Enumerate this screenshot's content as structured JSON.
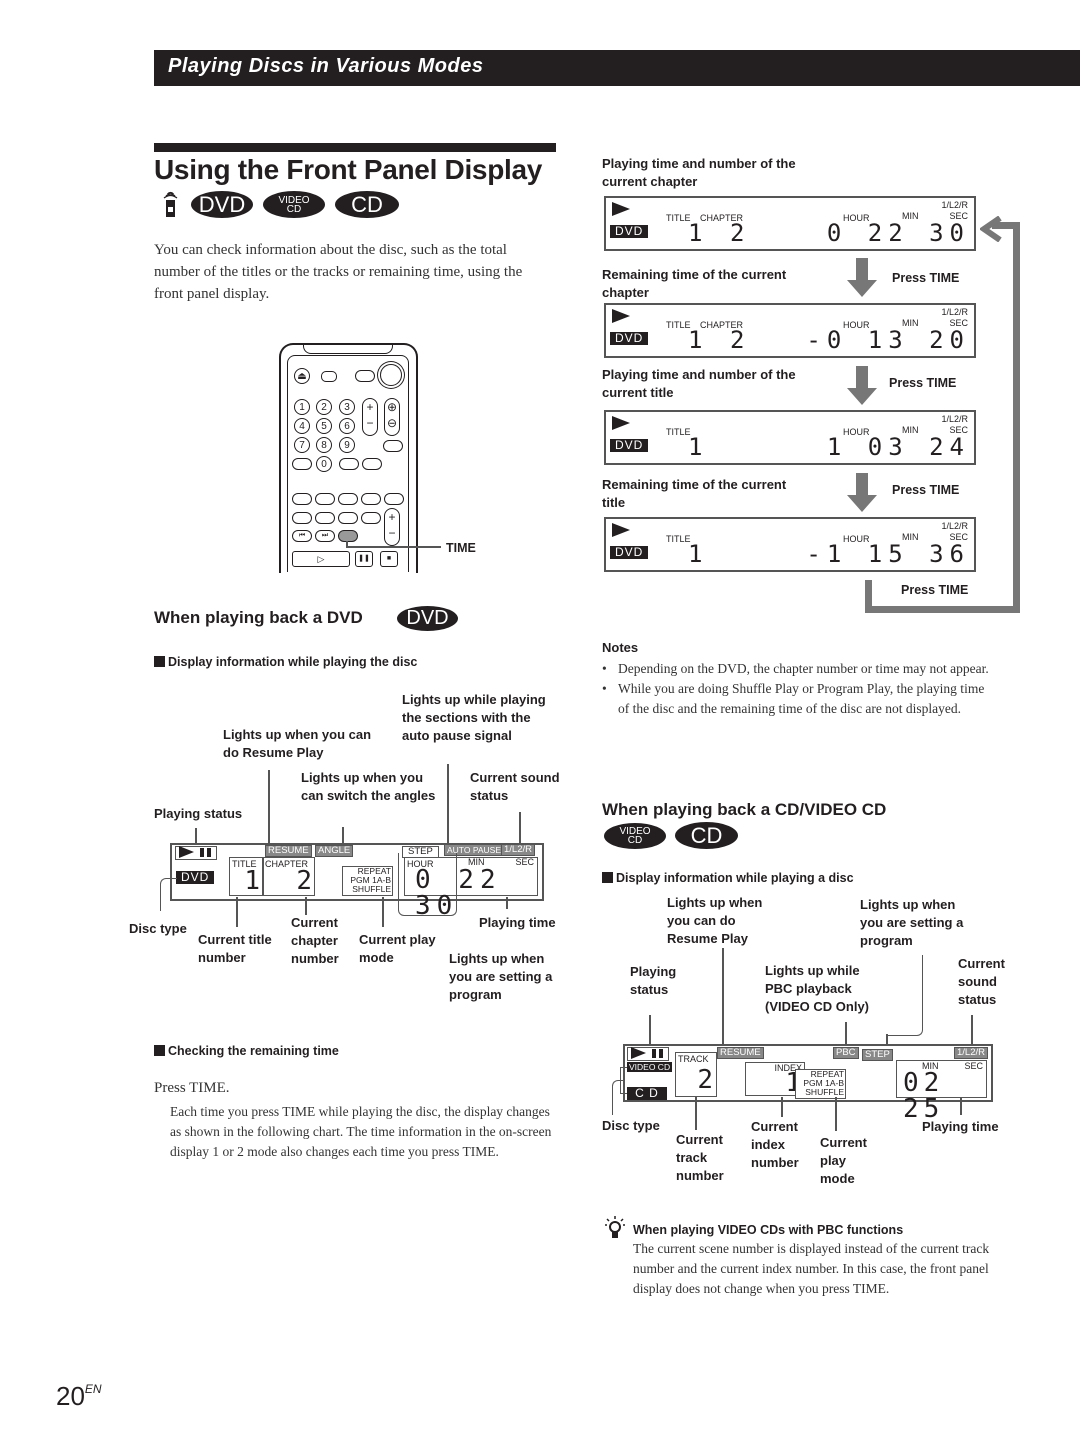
{
  "header": {
    "section_title": "Playing Discs in Various Modes"
  },
  "page": {
    "title": "Using the Front Panel Display",
    "badges": {
      "dvd": "DVD",
      "video_cd_top": "VIDEO",
      "video_cd_bottom": "CD",
      "cd": "CD"
    },
    "intro": "You can check information about the disc, such as the total number of the titles or the tracks or remaining time, using the front panel display.",
    "page_number": "20",
    "page_suffix": "EN"
  },
  "remote": {
    "time_label": "TIME",
    "numbers": [
      "1",
      "2",
      "3",
      "4",
      "5",
      "6",
      "7",
      "8",
      "9",
      "0"
    ]
  },
  "dvd_section": {
    "heading": "When playing back a DVD",
    "badge": "DVD",
    "subheading": "Display information while playing the disc",
    "callouts": {
      "resume": "Lights up when you can do Resume Play",
      "auto_pause": "Lights up while playing the sections with the auto pause signal",
      "angle": "Lights up when you can switch the angles",
      "sound": "Current sound status",
      "playing_status": "Playing status",
      "disc_type": "Disc type",
      "title_number": "Current title number",
      "chapter_number": "Current chapter number",
      "play_mode": "Current play mode",
      "program": "Lights up when you are setting a program",
      "playing_time": "Playing time"
    },
    "display": {
      "disc": "DVD",
      "resume": "RESUME",
      "angle": "ANGLE",
      "step": "STEP",
      "auto_pause": "AUTO PAUSE",
      "audio": "1/L2/R",
      "title_label": "TITLE",
      "chapter_label": "CHAPTER",
      "title_value": "1",
      "chapter_value": "2",
      "mode_lines": [
        "REPEAT",
        "PGM 1A-B",
        "SHUFFLE"
      ],
      "hour_label": "HOUR",
      "min_label": "MIN",
      "sec_label": "SEC",
      "time_value": "0 22 30"
    },
    "remaining": {
      "subheading": "Checking the remaining time",
      "step": "Press TIME.",
      "body": "Each time you press TIME while playing the disc, the display changes as shown in the following chart.  The time information in the on-screen display 1 or 2 mode also changes each time you press TIME."
    }
  },
  "time_chart": {
    "press_label": "Press TIME",
    "states": [
      {
        "caption": "Playing time and number of the current chapter",
        "labels": [
          "TITLE",
          "CHAPTER"
        ],
        "values": [
          "1",
          "2"
        ],
        "time": "0 22 30",
        "disc": "DVD",
        "audio": "1/L2/R"
      },
      {
        "caption": "Remaining time of the current chapter",
        "labels": [
          "TITLE",
          "CHAPTER"
        ],
        "values": [
          "1",
          "2"
        ],
        "time": "-0 13 20",
        "disc": "DVD",
        "audio": "1/L2/R"
      },
      {
        "caption": "Playing time and number of the current title",
        "labels": [
          "TITLE"
        ],
        "values": [
          "1"
        ],
        "time": "1 03 24",
        "disc": "DVD",
        "audio": "1/L2/R"
      },
      {
        "caption": "Remaining time of the current title",
        "labels": [
          "TITLE"
        ],
        "values": [
          "1"
        ],
        "time": "-1 15 36",
        "disc": "DVD",
        "audio": "1/L2/R"
      }
    ],
    "hour_label": "HOUR",
    "min_label": "MIN",
    "sec_label": "SEC"
  },
  "notes": {
    "heading": "Notes",
    "items": [
      "Depending on the DVD, the chapter number or time may not appear.",
      "While you are doing Shuffle Play or Program Play, the playing time of the disc and the remaining time of the disc are not displayed."
    ]
  },
  "cd_section": {
    "heading": "When playing back a CD/VIDEO CD",
    "badges": {
      "video_cd_top": "VIDEO",
      "video_cd_bottom": "CD",
      "cd": "CD"
    },
    "subheading": "Display information while playing a disc",
    "callouts": {
      "resume": "Lights up when you can do Resume Play",
      "program": "Lights up when you are setting a program",
      "playing_status": "Playing status",
      "pbc": "Lights up while PBC playback (VIDEO CD Only)",
      "sound": "Current sound status",
      "disc_type": "Disc type",
      "track_number": "Current track number",
      "index_number": "Current index number",
      "play_mode": "Current play mode",
      "playing_time": "Playing time"
    },
    "display": {
      "video_cd": "VIDEO CD",
      "cd": "C D",
      "track_label": "TRACK",
      "track_value": "2",
      "resume": "RESUME",
      "index_label": "INDEX",
      "index_value": "1",
      "pbc": "PBC",
      "step": "STEP",
      "audio": "1/L2/R",
      "mode_lines": [
        "REPEAT",
        "PGM 1A-B",
        "SHUFFLE"
      ],
      "min_label": "MIN",
      "sec_label": "SEC",
      "time_value": "02 25"
    },
    "tip": {
      "heading": "When playing VIDEO CDs with PBC functions",
      "body": "The current scene number is displayed instead of the current track number and the current index number.  In this case, the front panel display does not change when you press TIME."
    }
  }
}
